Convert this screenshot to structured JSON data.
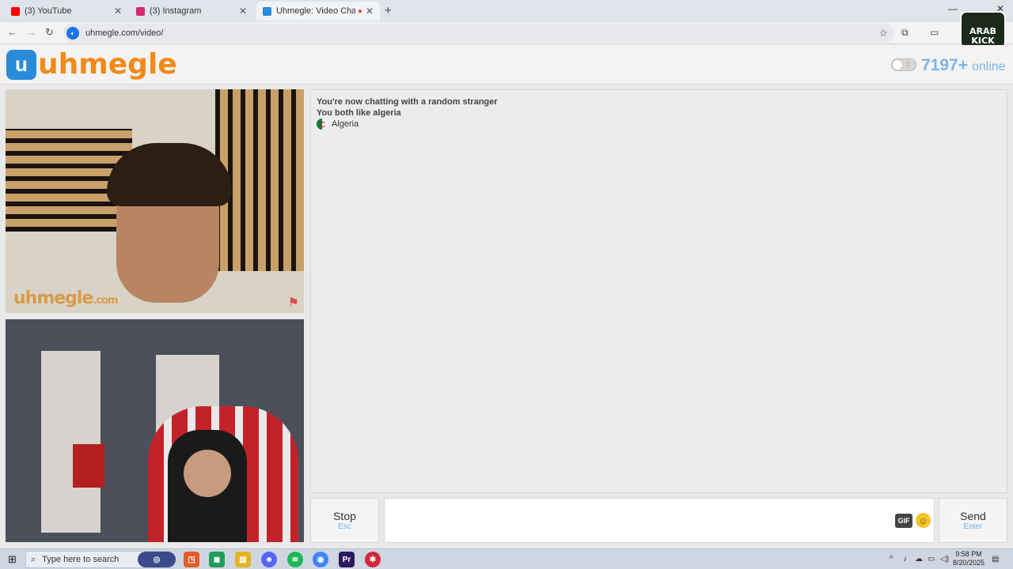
{
  "browser": {
    "tabs": [
      {
        "title": "(3) YouTube",
        "color": "#ff0000"
      },
      {
        "title": "(3) Instagram",
        "color": "#d62976"
      },
      {
        "title": "Uhmegle: Video Chat | Ome",
        "color": "#2a8bd8"
      }
    ],
    "new_tab": "+",
    "url": "uhmegle.com/video/"
  },
  "stream_overlay": {
    "logo_text": "ARAB KICK"
  },
  "site": {
    "logo_text": "uhmegle",
    "online_count": "7197+",
    "online_label": "online"
  },
  "video": {
    "watermark": "uhmegle",
    "watermark_suffix": ".com"
  },
  "chat": {
    "messages": [
      "You're now chatting with a random stranger",
      "You both like algeria"
    ],
    "country": "Algeria"
  },
  "controls": {
    "stop_label": "Stop",
    "stop_hint": "Esc",
    "send_label": "Send",
    "send_hint": "Enter",
    "gif_label": "GIF"
  },
  "taskbar": {
    "search_placeholder": "Type here to search",
    "time": "9:58 PM",
    "date": "8/20/2025"
  },
  "colors": {
    "accent": "#2a8bd8",
    "logo_orange": "#f08a1a",
    "online_blue": "#7fb4e5"
  }
}
